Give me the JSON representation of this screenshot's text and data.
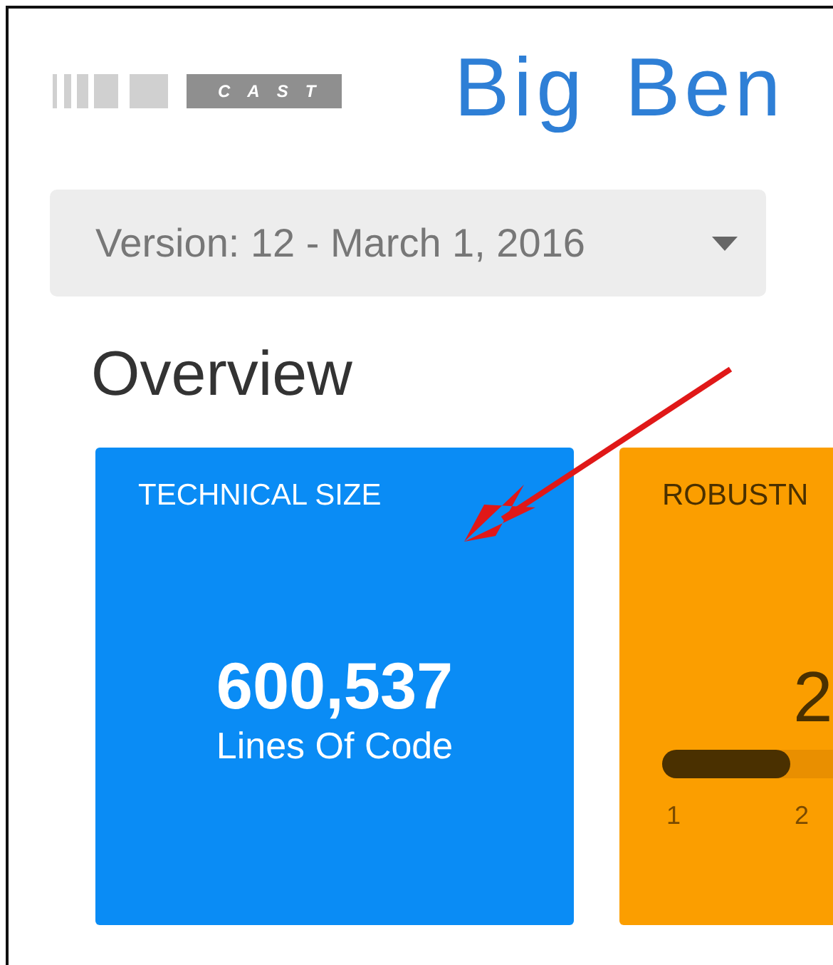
{
  "logo": {
    "text": "CAST"
  },
  "app_title": "Big Ben",
  "version_select": {
    "value": "Version: 12 - March 1, 2016"
  },
  "section_title": "Overview",
  "cards": [
    {
      "kind": "size",
      "title": "TECHNICAL SIZE",
      "value": "600,537",
      "caption": "Lines Of Code",
      "color": "#0a8cf5"
    },
    {
      "kind": "score",
      "title": "ROBUSTN",
      "value": "2",
      "level": 0.28,
      "ticks": [
        "1",
        "2"
      ],
      "color": "#fb9e00"
    }
  ],
  "annotation": {
    "kind": "arrow"
  }
}
